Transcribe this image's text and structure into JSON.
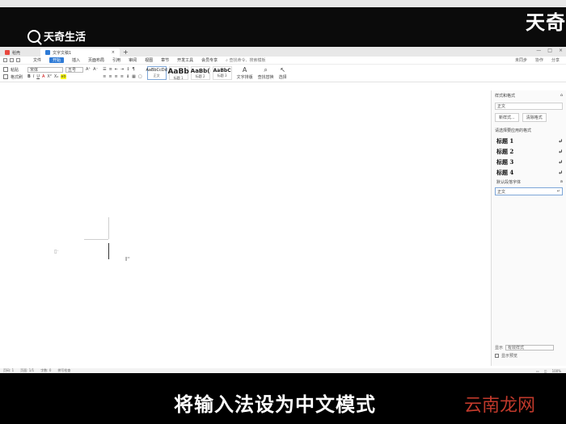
{
  "video": {
    "brand": "天奇生活",
    "corner_logo": "天奇",
    "caption": "将输入法设为中文模式",
    "watermark": "云南龙网"
  },
  "tabs": [
    {
      "label": "稻壳",
      "icon": "wps-logo-icon",
      "color": "#e8483f"
    },
    {
      "label": "文字文稿1",
      "icon": "document-icon",
      "color": "#2f7bd6"
    }
  ],
  "tab_new": "+",
  "menu": {
    "items": [
      "文件",
      "开始",
      "插入",
      "页面布局",
      "引用",
      "审阅",
      "视图",
      "章节",
      "开发工具",
      "会员专享"
    ],
    "active": "开始",
    "search_placeholder": "查找命令、搜索模板",
    "right": [
      "未同步",
      "协作",
      "分享"
    ]
  },
  "ribbon": {
    "clipboard": "粘贴",
    "format_painter": "格式刷",
    "font_name": "宋体",
    "font_size": "五号",
    "styles": [
      {
        "sample": "AaBbCcDd",
        "name": "正文"
      },
      {
        "sample": "AaBb",
        "name": "标题 1"
      },
      {
        "sample": "AaBb(",
        "name": "标题 2"
      },
      {
        "sample": "AaBbC",
        "name": "标题 3"
      }
    ],
    "text_tools": "文字排版",
    "find_replace": "查找替换",
    "select": "选择"
  },
  "panel": {
    "title": "样式和格式",
    "current_style": "正文",
    "btn_new": "新样式...",
    "btn_clear": "清除格式",
    "subtitle": "请选择要应用的格式",
    "styles": [
      "标题 1",
      "标题 2",
      "标题 3",
      "标题 4"
    ],
    "default_font": "默认段落字体",
    "selected": "正文",
    "show_label": "显示",
    "show_value": "有效样式",
    "preview": "显示预览"
  },
  "status": {
    "page": "页码: 1",
    "pages": "页面: 1/1",
    "words": "字数: 0",
    "spell": "拼写检查",
    "zoom": "100%"
  }
}
